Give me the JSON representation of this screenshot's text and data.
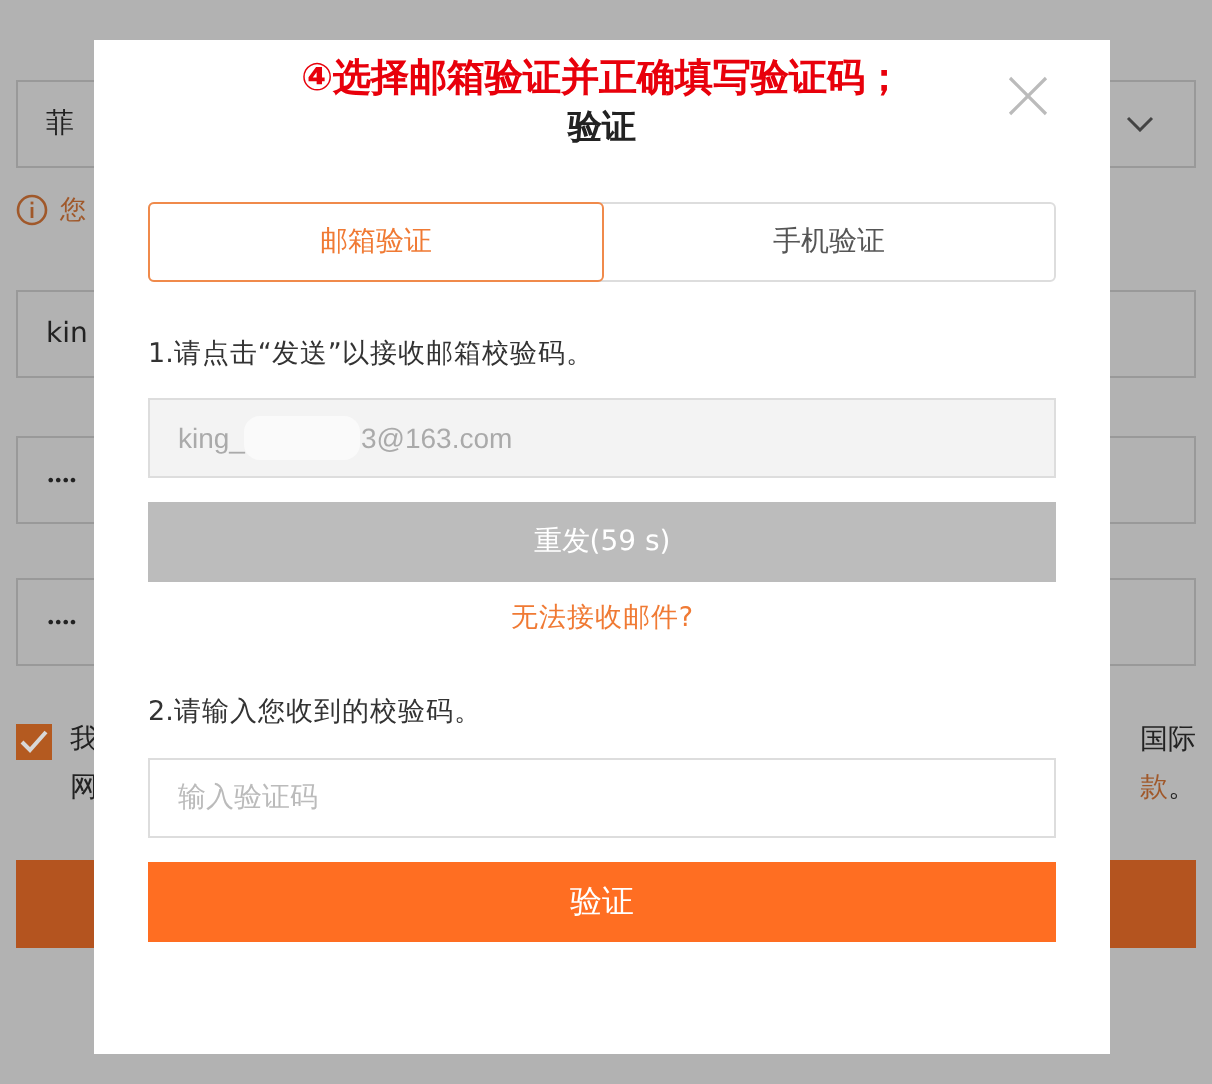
{
  "background": {
    "country_field": {
      "value": "菲"
    },
    "notice": "您",
    "account_field": {
      "value": "kin"
    },
    "password_fields": [
      {
        "value": "••••"
      },
      {
        "value": "••••"
      }
    ],
    "agreement": {
      "checked": true,
      "left_lines": [
        "我",
        "网"
      ],
      "right_text": "国际",
      "right_link": "款",
      "right_end": "。"
    }
  },
  "annotation": "④选择邮箱验证并正确填写验证码；",
  "dialog": {
    "title": "验证",
    "tabs": [
      {
        "label": "邮箱验证",
        "selected": true
      },
      {
        "label": "手机验证",
        "selected": false
      }
    ],
    "step_1": "1.请点击“发送”以接收邮箱校验码。",
    "email_field": {
      "value_start": "king_",
      "value_end": "3@163.com"
    },
    "resend_button": {
      "label": "重发(59 s)",
      "disabled": true
    },
    "help_link": "无法接收邮件?",
    "step_2": "2.请输入您收到的校验码。",
    "code_field": {
      "placeholder": "输入验证码"
    },
    "verify_button": {
      "label": "验证"
    }
  }
}
